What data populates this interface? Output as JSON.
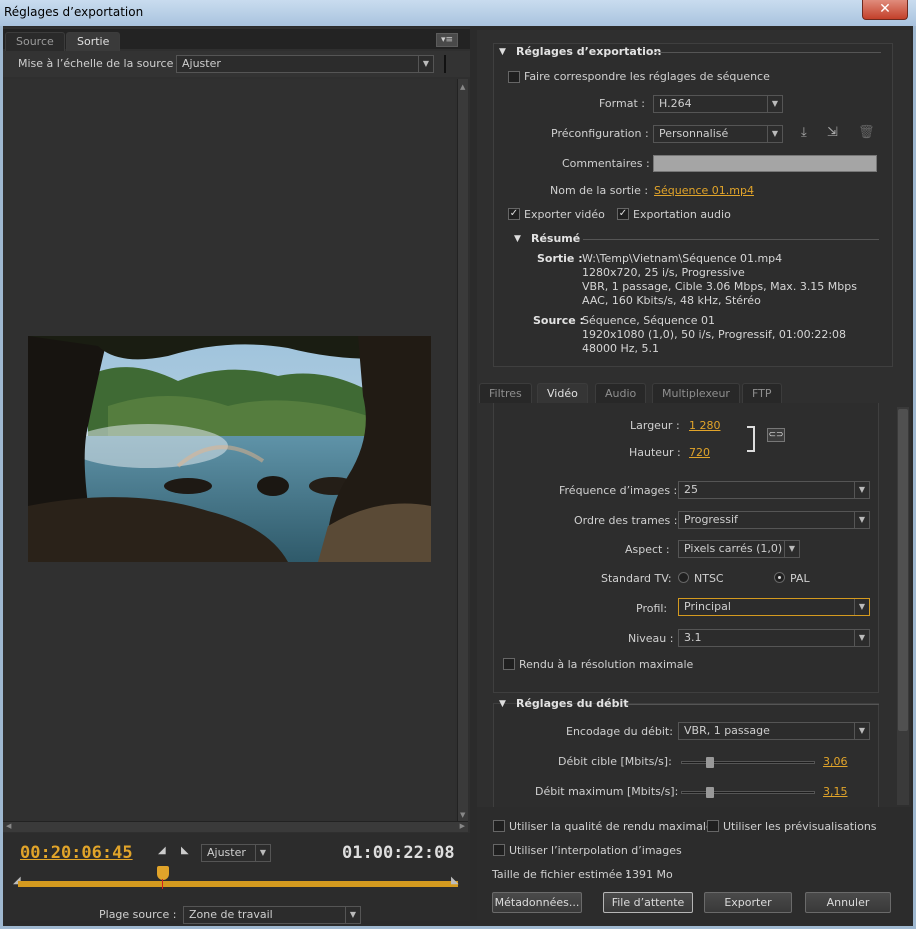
{
  "window": {
    "title": "Réglages d’exportation",
    "close_glyph": "✕"
  },
  "left": {
    "tabs": [
      {
        "label": "Source"
      },
      {
        "label": "Sortie"
      }
    ],
    "menu_glyph": "▾≡",
    "scale_label": "Mise à l’échelle de la source :",
    "scale_value": "Ajuster",
    "timecode_in": "00:20:06:45",
    "timecode_out": "01:00:22:08",
    "zoom_value": "Ajuster",
    "range_label": "Plage source :",
    "range_value": "Zone de travail"
  },
  "export": {
    "section_title": "Réglages d’exportation",
    "match_sequence": "Faire correspondre les réglages de séquence",
    "format_label": "Format :",
    "format_value": "H.264",
    "preset_label": "Préconfiguration :",
    "preset_value": "Personnalisé",
    "comments_label": "Commentaires :",
    "output_name_label": "Nom de la sortie :",
    "output_name_value": "Séquence 01.mp4",
    "export_video": "Exporter vidéo",
    "export_audio": "Exportation audio",
    "summary_title": "Résumé",
    "summary_output_label": "Sortie :",
    "summary_output_lines": [
      "W:\\Temp\\Vietnam\\Séquence 01.mp4",
      "1280x720, 25 i/s, Progressive",
      "VBR, 1 passage, Cible 3.06 Mbps, Max. 3.15 Mbps",
      "AAC, 160  Kbits/s, 48  kHz, Stéréo"
    ],
    "summary_source_label": "Source :",
    "summary_source_lines": [
      "Séquence, Séquence 01",
      "1920x1080 (1,0), 50  i/s, Progressif, 01:00:22:08",
      "48000 Hz, 5.1"
    ]
  },
  "tabs": [
    {
      "label": "Filtres"
    },
    {
      "label": "Vidéo"
    },
    {
      "label": "Audio"
    },
    {
      "label": "Multiplexeur"
    },
    {
      "label": "FTP"
    }
  ],
  "video": {
    "width_label": "Largeur :",
    "width_value": "1 280",
    "height_label": "Hauteur :",
    "height_value": "720",
    "framerate_label": "Fréquence d’images :",
    "framerate_value": "25",
    "field_order_label": "Ordre des trames :",
    "field_order_value": "Progressif",
    "aspect_label": "Aspect :",
    "aspect_value": "Pixels carrés (1,0)",
    "tv_standard_label": "Standard TV:",
    "ntsc": "NTSC",
    "pal": "PAL",
    "profile_label": "Profil:",
    "profile_value": "Principal",
    "level_label": "Niveau :",
    "level_value": "3.1",
    "max_render": "Rendu à la résolution maximale"
  },
  "bitrate": {
    "section_title": "Réglages du débit",
    "encoding_label": "Encodage du débit:",
    "encoding_value": "VBR, 1 passage",
    "target_label": "Débit cible [Mbits/s]:",
    "target_value": "3,06",
    "target_position": 0.22,
    "max_label": "Débit maximum [Mbits/s]:",
    "max_value": "3,15",
    "max_position": 0.22
  },
  "footer": {
    "max_quality": "Utiliser la qualité de rendu maximale",
    "use_previews": "Utiliser les prévisualisations",
    "frame_blending": "Utiliser l’interpolation d’images",
    "filesize_label": "Taille de fichier estimée :",
    "filesize_value": "1391 Mo",
    "metadata_button": "Métadonnées...",
    "queue_button": "File d’attente",
    "export_button": "Exporter",
    "cancel_button": "Annuler"
  },
  "colors": {
    "accent": "#e1a42a",
    "panel": "#2f2f2f",
    "titlebar": "#b8cfe6"
  }
}
